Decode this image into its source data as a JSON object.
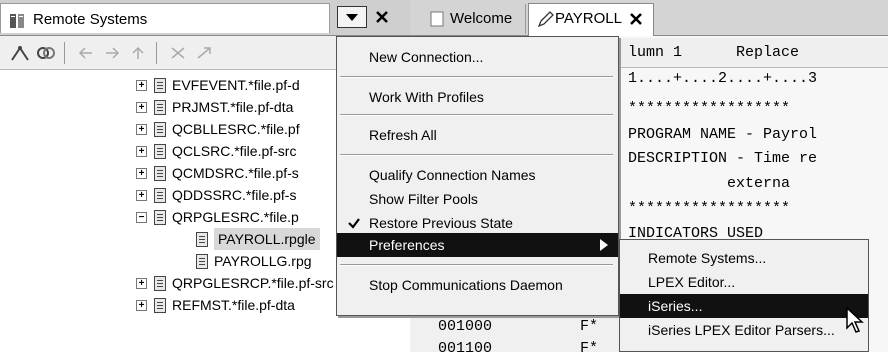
{
  "remote_systems_view": {
    "title": "Remote Systems",
    "tree": [
      {
        "label": "EVFEVENT.*file.pf-d",
        "toggle": "+",
        "indent": 1
      },
      {
        "label": "PRJMST.*file.pf-dta",
        "toggle": "+",
        "indent": 1
      },
      {
        "label": "QCBLLESRC.*file.pf",
        "toggle": "+",
        "indent": 1
      },
      {
        "label": "QCLSRC.*file.pf-src",
        "toggle": "+",
        "indent": 1
      },
      {
        "label": "QCMDSRC.*file.pf-s",
        "toggle": "+",
        "indent": 1
      },
      {
        "label": "QDDSSRC.*file.pf-s",
        "toggle": "+",
        "indent": 1
      },
      {
        "label": "QRPGLESRC.*file.p",
        "toggle": "-",
        "indent": 1
      },
      {
        "label": "PAYROLL.rpgle",
        "toggle": "",
        "indent": 2,
        "selected": true
      },
      {
        "label": "PAYROLLG.rpg",
        "toggle": "",
        "indent": 2
      },
      {
        "label": "QRPGLESRCP.*file.pf-src",
        "toggle": "+",
        "indent": 1
      },
      {
        "label": "REFMST.*file.pf-dta",
        "toggle": "+",
        "indent": 1
      }
    ]
  },
  "editor": {
    "tabs": [
      {
        "label": "Welcome"
      },
      {
        "label": "PAYROLL",
        "active": true
      }
    ],
    "ruler_title": "lumn 1      Replace",
    "ruler_scale": "1....+....2....+....3",
    "lines": [
      "******************",
      "PROGRAM NAME - Payrol",
      "DESCRIPTION - Time re",
      "           externa",
      "******************",
      "INDICATORS USED"
    ],
    "seq_lines": [
      {
        "seq": "001000",
        "mark": "F*"
      },
      {
        "seq": "001100",
        "mark": "F*"
      }
    ]
  },
  "context_menu": {
    "items": [
      {
        "label": "New Connection...",
        "group": 0
      },
      {
        "label": "Work With Profiles",
        "group": 1
      },
      {
        "label": "Refresh All",
        "group": 2
      },
      {
        "label": "Qualify Connection Names",
        "group": 3
      },
      {
        "label": "Show Filter Pools",
        "group": 3
      },
      {
        "label": "Restore Previous State",
        "group": 3,
        "checked": true
      },
      {
        "label": "Preferences",
        "group": 3,
        "highlighted": true,
        "submenu": true
      },
      {
        "label": "Stop Communications Daemon",
        "group": 4
      }
    ],
    "submenu": [
      {
        "label": "Remote Systems..."
      },
      {
        "label": "LPEX Editor..."
      },
      {
        "label": "iSeries...",
        "highlighted": true
      },
      {
        "label": "iSeries LPEX Editor Parsers..."
      }
    ]
  },
  "icons": {
    "view": "remote-systems-icon",
    "menu_dropdown": "chevron-down-icon",
    "close": "close-icon",
    "check": "checkmark-icon",
    "submenu_arrow": "triangle-right-icon",
    "pointer": "mouse-pointer-icon"
  }
}
